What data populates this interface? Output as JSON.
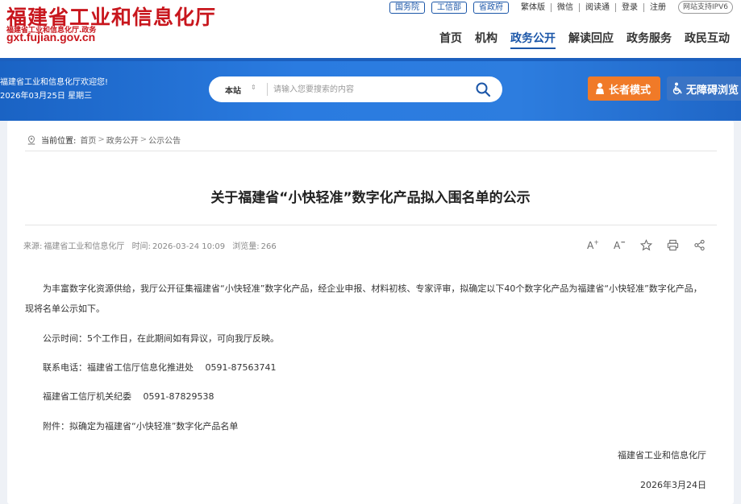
{
  "header": {
    "logo_cn": "福建省工业和信息化厅",
    "logo_sub": "福建省工业和信息化厅.政务",
    "logo_url": "gxt.fujian.gov.cn",
    "top_pills": [
      "国务院",
      "工信部",
      "省政府"
    ],
    "top_links": [
      "繁体版",
      "微信",
      "阅读通",
      "登录",
      "注册"
    ],
    "ipv6": "网站支持IPV6",
    "nav": [
      "首页",
      "机构",
      "政务公开",
      "解读回应",
      "政务服务",
      "政民互动"
    ],
    "nav_active": "政务公开"
  },
  "banner": {
    "welcome": "福建省工业和信息化厅欢迎您!",
    "date": "2026年03月25日 星期三",
    "search_scope": "本站",
    "search_placeholder": "请输入您要搜索的内容",
    "elder_mode": "长者模式",
    "accessible": "无障碍浏览"
  },
  "breadcrumb": {
    "label": "当前位置:",
    "items": [
      "首页",
      "政务公开",
      "公示公告"
    ],
    "sep": ">"
  },
  "article": {
    "title": "关于福建省“小快轻准”数字化产品拟入围名单的公示",
    "source_label": "来源:",
    "source": "福建省工业和信息化厅",
    "time_label": "时间:",
    "time": "2026-03-24 10:09",
    "views_label": "浏览量:",
    "views": "266",
    "tools": {
      "font_up": "A⁺",
      "font_down": "A⁻"
    },
    "p1": "为丰富数字化资源供给，我厅公开征集福建省“小快轻准”数字化产品，经企业申报、材料初核、专家评审，拟确定以下40个数字化产品为福建省“小快轻准”数字化产品，现将名单公示如下。",
    "p2": "公示时间：5个工作日，在此期间如有异议，可向我厅反映。",
    "p3": "联系电话：福建省工信厅信息化推进处　 0591-87563741",
    "p4": "福建省工信厅机关纪委　 0591-87829538",
    "p5": "附件：拟确定为福建省“小快轻准”数字化产品名单",
    "sign_org": "福建省工业和信息化厅",
    "sign_date": "2026年3月24日"
  }
}
